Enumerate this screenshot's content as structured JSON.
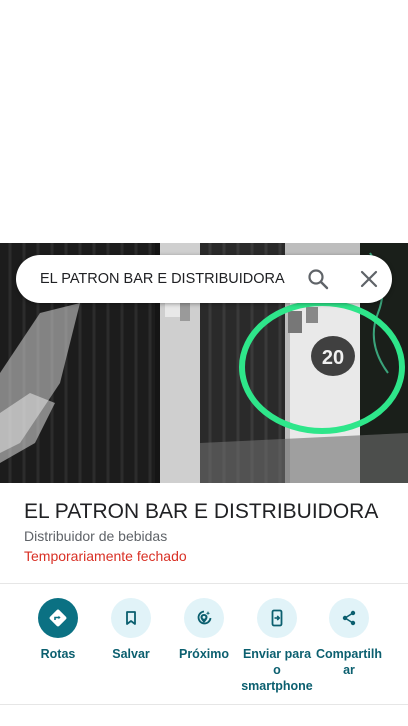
{
  "search": {
    "query": "EL PATRON BAR E DISTRIBUIDORA"
  },
  "photo": {
    "door_number": "20"
  },
  "place": {
    "name": "EL PATRON BAR E DISTRIBUIDORA",
    "category": "Distribuidor de bebidas",
    "status": "Temporariamente fechado"
  },
  "actions": [
    {
      "label": "Rotas",
      "icon": "directions-icon"
    },
    {
      "label": "Salvar",
      "icon": "bookmark-icon"
    },
    {
      "label": "Próximo",
      "icon": "nearby-icon"
    },
    {
      "label": "Enviar para o smartphone",
      "icon": "send-to-phone-icon"
    },
    {
      "label": "Compartilhar",
      "icon": "share-icon"
    }
  ],
  "colors": {
    "accent": "#0b7183",
    "status_closed": "#d93025",
    "highlight_circle": "#2ee68a"
  }
}
